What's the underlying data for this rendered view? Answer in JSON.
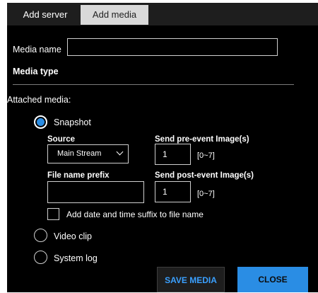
{
  "tabs": {
    "add_server": "Add server",
    "add_media": "Add media"
  },
  "media_name": {
    "label": "Media name",
    "value": ""
  },
  "media_type_heading": "Media type",
  "attached_media_label": "Attached media:",
  "options": {
    "snapshot": {
      "label": "Snapshot",
      "checked": true
    },
    "video_clip": {
      "label": "Video clip",
      "checked": false
    },
    "system_log": {
      "label": "System log",
      "checked": false
    }
  },
  "snapshot_settings": {
    "source_label": "Source",
    "source_value": "Main Stream",
    "pre_event_label": "Send pre-event Image(s)",
    "pre_event_value": "1",
    "pre_event_range": "[0~7]",
    "file_prefix_label": "File name prefix",
    "file_prefix_value": "",
    "post_event_label": "Send post-event Image(s)",
    "post_event_value": "1",
    "post_event_range": "[0~7]",
    "suffix_checkbox_label": "Add date and time suffix to file name",
    "suffix_checked": false
  },
  "buttons": {
    "save": "SAVE MEDIA",
    "close": "CLOSE"
  },
  "colors": {
    "accent": "#2a8de4",
    "background": "#000000",
    "tab_active": "#d9d9d9"
  }
}
